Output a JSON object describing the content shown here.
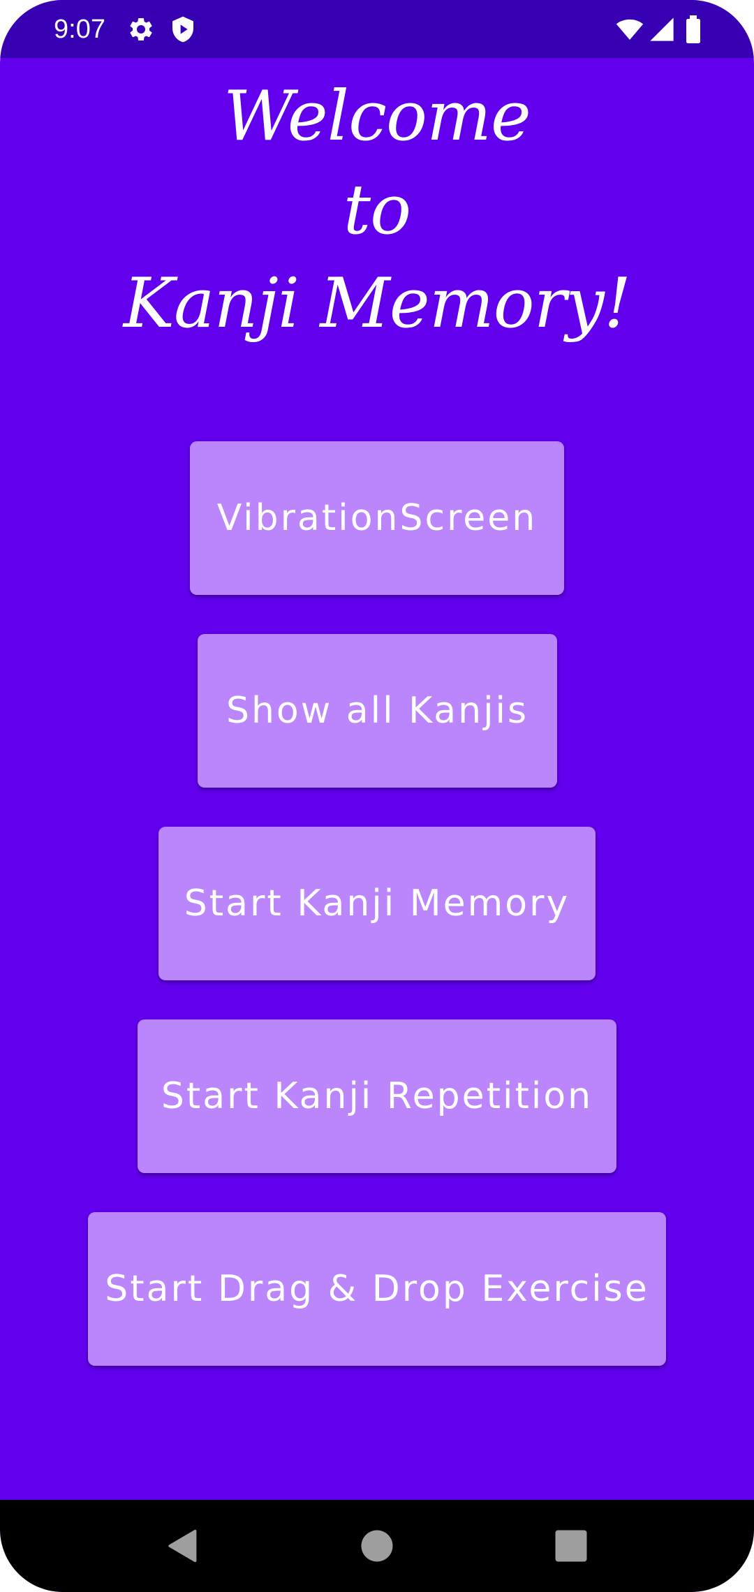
{
  "status_bar": {
    "time": "9:07",
    "icons": [
      "gear-icon",
      "shield-play-icon",
      "wifi-icon",
      "signal-icon",
      "battery-icon"
    ]
  },
  "title": {
    "line1": "Welcome",
    "line2": "to",
    "line3": "Kanji Memory!"
  },
  "buttons": {
    "vibration": "VibrationScreen",
    "show_all": "Show all Kanjis",
    "start_memory": "Start Kanji Memory",
    "start_repetition": "Start Kanji Repetition",
    "start_drag_drop": "Start Drag & Drop Exercise"
  },
  "nav_bar": {
    "icons": [
      "back-icon",
      "home-icon",
      "recents-icon"
    ]
  },
  "colors": {
    "status_bar": "#3700B3",
    "background": "#6200EE",
    "button": "#BB86FC",
    "text": "#FFFFFF",
    "nav_bar": "#000000"
  }
}
